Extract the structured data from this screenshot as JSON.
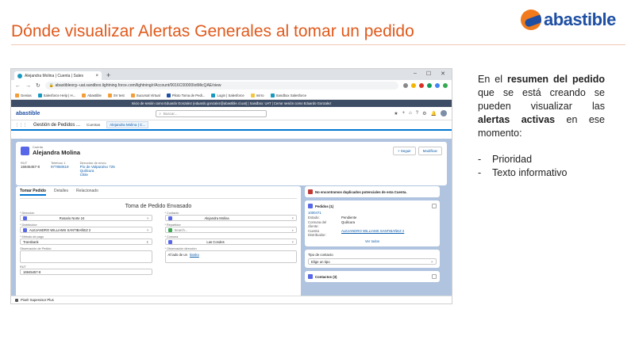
{
  "slide": {
    "title": "Dónde visualizar Alertas Generales al tomar un pedido",
    "logo_text": "abastible"
  },
  "browser": {
    "tab_title": "Alejandra Molina | Cuenta | Sales",
    "url": "abastibleorg--uat.sandbox.lightning.force.com/lightning/r/Account/0016C00000IotMicQAE/view",
    "bookmarks": [
      "Genias",
      "Salesforce Help | H...",
      "Abastible",
      "SV test",
      "Sucursal Virtual",
      "Piloto Toma de Pedi...",
      "Login | Salesforce",
      "mirro",
      "Sandbox Salesforce"
    ],
    "sandbox_banner": "Inicio de sesión como Eduardo Gonzalez (eduardo.gonzalez@abastible.cl.uat) | Sandbox: UAT | Cerrar sesión como Eduardo Gonzalez"
  },
  "salesforce": {
    "logo": "abastible",
    "search_placeholder": "Buscar...",
    "app_name": "Gestión de Pedidos ...",
    "nav_tabs": [
      "Cuentas",
      "Alejandra Molina | C..."
    ],
    "account": {
      "type_label": "Cuenta",
      "name": "Alejandra Molina",
      "follow_label": "+ Seguir",
      "edit_label": "Modificar",
      "rut_label": "RUT",
      "rut": "16945457-8",
      "phone_label": "Teléfono 1",
      "phone": "977850519",
      "address_label": "Dirección de envío",
      "address_lines": [
        "Pío de Valparaíso 725",
        "Quilicura",
        "Chile"
      ]
    },
    "main_tabs": [
      "Tomar Pedido",
      "Detalles",
      "Relacionado"
    ],
    "form": {
      "title": "Toma de Pedido Envasado",
      "direccion_label": "* Dirección",
      "direccion": "Rosario Norte 24",
      "contacto_label": "* Contacto",
      "contacto": "Alejandra Molina",
      "distribuidor_label": "* Distribuidor",
      "distribuidor": "ALEJANDRO WILLIAMS SANTIBAÑEZ 2",
      "repartidor_label": "* Repartidor",
      "repartidor_placeholder": "Search...",
      "metodo_label": "* Método de pago",
      "metodo": "Transbank",
      "comuna_label": "* Comuna",
      "comuna": "Las Condes",
      "obs_pedido_label": "Observación de Pedido",
      "obs_direccion_label": "* Observación dirección",
      "obs_direccion_prefix": "Al lado de un",
      "obs_direccion_link": "kiosko",
      "rut_label": "RUT",
      "rut": "16945457-8"
    },
    "right": {
      "duplicates": "No encontramos duplicados potenciales de esta Cuenta.",
      "pedidos_title": "Pedidos (1)",
      "pedido_number": "1000471",
      "estado_label": "Estado:",
      "estado": "Pendiente",
      "comuna_label": "Comuna del cliente:",
      "comuna": "Quilicura",
      "dist_label": "Cuenta Distribuidor:",
      "dist": "ALEJANDRO WILLIAMS SANTIBAÑEZ 2",
      "ver_todos": "Ver todos",
      "tipo_label": "Tipo de contacto",
      "tipo_placeholder": "Elige un tipo",
      "contactos_title": "Contactos (3)"
    },
    "utility": "Pixel! Supervisor Plus"
  },
  "notes": {
    "intro_1": "En el",
    "intro_bold_1": "resumen del pedido",
    "intro_2": "que se está creando se pueden visualizar las",
    "intro_bold_2": "alertas activas",
    "intro_3": "en ese momento:",
    "items": [
      "Prioridad",
      "Texto informativo"
    ]
  },
  "colors": {
    "title": "#e05a1c",
    "brand_blue": "#1e4fa3",
    "brand_orange": "#f07a1c",
    "sf_blue": "#0176d3"
  }
}
